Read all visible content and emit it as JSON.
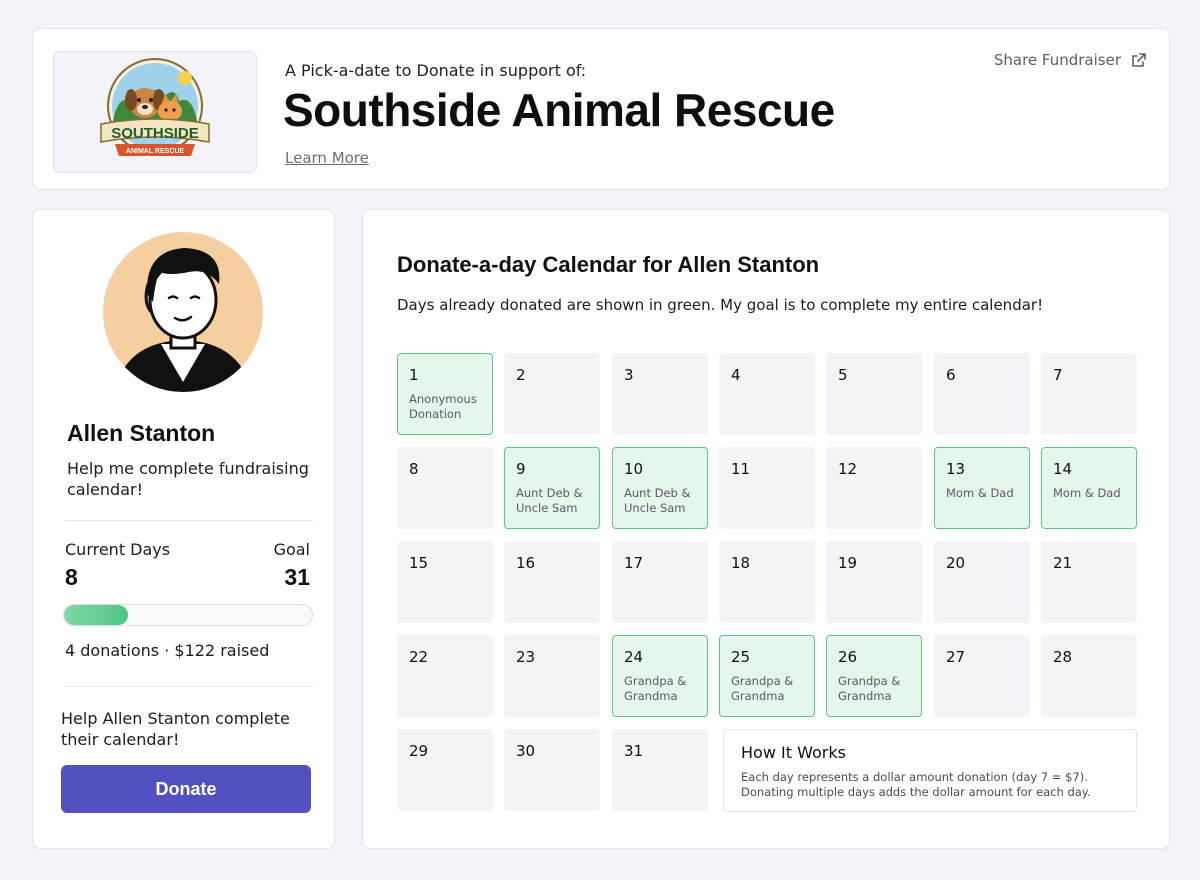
{
  "header": {
    "subtitle": "A Pick-a-date to Donate in support of:",
    "title": "Southside Animal Rescue",
    "learn_more": "Learn More",
    "share_label": "Share Fundraiser",
    "logo": {
      "word": "SOUTHSIDE",
      "banner": "ANIMAL RESCUE"
    }
  },
  "profile": {
    "name": "Allen Stanton",
    "tagline": "Help me complete fundraising calendar!",
    "current_label": "Current Days",
    "current_value": "8",
    "goal_label": "Goal",
    "goal_value": "31",
    "progress_fraction": 0.26,
    "donations_text": "4 donations · $122 raised",
    "help_text": "Help Allen Stanton complete their calendar!",
    "donate_label": "Donate"
  },
  "calendar": {
    "title": "Donate-a-day Calendar for Allen Stanton",
    "description": "Days already donated are shown in green. My goal is to complete my entire calendar!",
    "days": [
      {
        "day": "1",
        "donor": "Anonymous Donation"
      },
      {
        "day": "2",
        "donor": ""
      },
      {
        "day": "3",
        "donor": ""
      },
      {
        "day": "4",
        "donor": ""
      },
      {
        "day": "5",
        "donor": ""
      },
      {
        "day": "6",
        "donor": ""
      },
      {
        "day": "7",
        "donor": ""
      },
      {
        "day": "8",
        "donor": ""
      },
      {
        "day": "9",
        "donor": "Aunt Deb & Uncle Sam"
      },
      {
        "day": "10",
        "donor": "Aunt Deb & Uncle Sam"
      },
      {
        "day": "11",
        "donor": ""
      },
      {
        "day": "12",
        "donor": ""
      },
      {
        "day": "13",
        "donor": "Mom & Dad"
      },
      {
        "day": "14",
        "donor": "Mom & Dad"
      },
      {
        "day": "15",
        "donor": ""
      },
      {
        "day": "16",
        "donor": ""
      },
      {
        "day": "17",
        "donor": ""
      },
      {
        "day": "18",
        "donor": ""
      },
      {
        "day": "19",
        "donor": ""
      },
      {
        "day": "20",
        "donor": ""
      },
      {
        "day": "21",
        "donor": ""
      },
      {
        "day": "22",
        "donor": ""
      },
      {
        "day": "23",
        "donor": ""
      },
      {
        "day": "24",
        "donor": "Grandpa & Grandma"
      },
      {
        "day": "25",
        "donor": "Grandpa & Grandma"
      },
      {
        "day": "26",
        "donor": "Grandpa & Grandma"
      },
      {
        "day": "27",
        "donor": ""
      },
      {
        "day": "28",
        "donor": ""
      },
      {
        "day": "29",
        "donor": ""
      },
      {
        "day": "30",
        "donor": ""
      },
      {
        "day": "31",
        "donor": ""
      }
    ],
    "how_it_works": {
      "title": "How It Works",
      "text": "Each day represents a dollar amount donation (day 7 = $7). Donating multiple days adds the dollar amount for each day."
    }
  },
  "colors": {
    "accent": "#5351c0",
    "donated_bg": "#e4f7ea",
    "donated_border": "#5ec585",
    "progress": "#4fc683"
  }
}
